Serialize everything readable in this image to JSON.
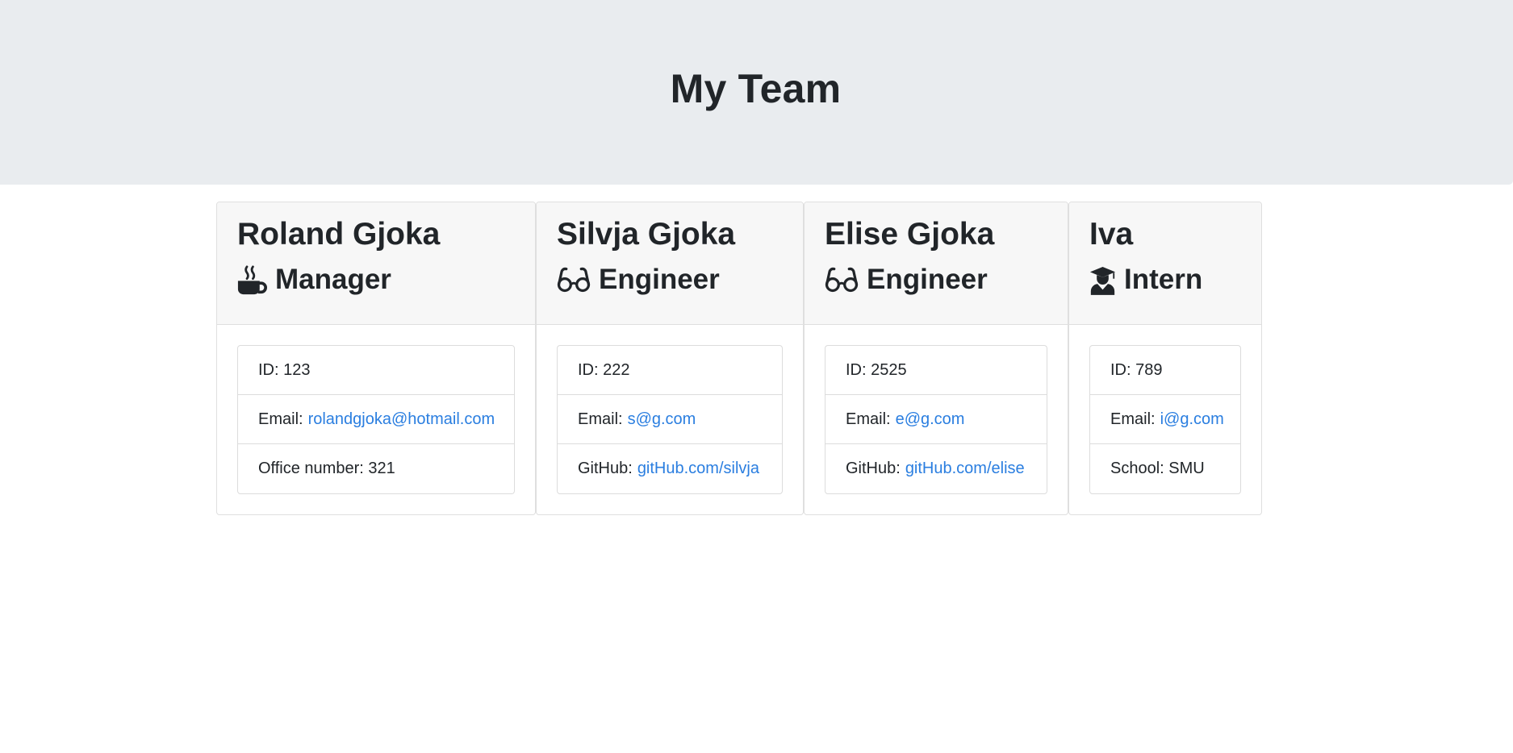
{
  "header": {
    "title": "My Team"
  },
  "team": [
    {
      "name": "Roland Gjoka",
      "role": "Manager",
      "icon": "mug-icon",
      "id_label": "ID: 123",
      "email_label": "Email:",
      "email": "rolandgjoka@hotmail.com",
      "extra_label": "Office number: 321",
      "extra_link": ""
    },
    {
      "name": "Silvja Gjoka",
      "role": "Engineer",
      "icon": "glasses-icon",
      "id_label": "ID: 222",
      "email_label": "Email:",
      "email": "s@g.com",
      "extra_label": "GitHub:",
      "extra_link": "gitHub.com/silvja"
    },
    {
      "name": "Elise Gjoka",
      "role": "Engineer",
      "icon": "glasses-icon",
      "id_label": "ID: 2525",
      "email_label": "Email:",
      "email": "e@g.com",
      "extra_label": "GitHub:",
      "extra_link": "gitHub.com/elise"
    },
    {
      "name": "Iva",
      "role": "Intern",
      "icon": "graduate-icon",
      "id_label": "ID: 789",
      "email_label": "Email:",
      "email": "i@g.com",
      "extra_label": "School: SMU",
      "extra_link": ""
    }
  ],
  "colors": {
    "jumbotron_bg": "#e9ecef",
    "card_header_bg": "#f7f7f7",
    "link": "#2a7ee0",
    "text": "#212529"
  }
}
